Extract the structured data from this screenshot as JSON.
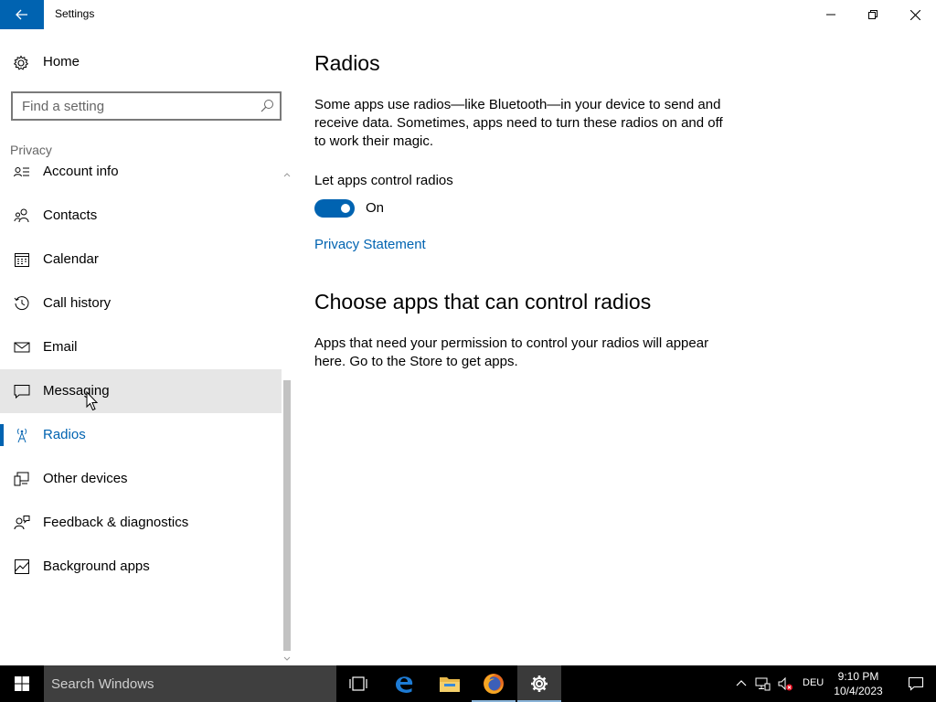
{
  "window": {
    "title": "Settings",
    "icons": {
      "back": "back-arrow-icon",
      "minimize": "minimize-icon",
      "maximize": "restore-icon",
      "close": "close-icon"
    }
  },
  "sidebar": {
    "home_label": "Home",
    "home_icon": "gear-icon",
    "search_placeholder": "Find a setting",
    "section_label": "Privacy",
    "items": [
      {
        "label": "Account info",
        "icon": "account-info-icon"
      },
      {
        "label": "Contacts",
        "icon": "contacts-icon"
      },
      {
        "label": "Calendar",
        "icon": "calendar-icon"
      },
      {
        "label": "Call history",
        "icon": "history-icon"
      },
      {
        "label": "Email",
        "icon": "mail-icon"
      },
      {
        "label": "Messaging",
        "icon": "chat-icon",
        "state": "hover"
      },
      {
        "label": "Radios",
        "icon": "radio-tower-icon",
        "state": "selected"
      },
      {
        "label": "Other devices",
        "icon": "devices-icon"
      },
      {
        "label": "Feedback & diagnostics",
        "icon": "feedback-icon"
      },
      {
        "label": "Background apps",
        "icon": "background-apps-icon"
      }
    ]
  },
  "main": {
    "title": "Radios",
    "description": "Some apps use radios—like Bluetooth—in your device to send and receive data. Sometimes, apps need to turn these radios on and off to work their magic.",
    "toggle_label": "Let apps control radios",
    "toggle_on": true,
    "toggle_state": "On",
    "privacy_link": "Privacy Statement",
    "subtitle": "Choose apps that can control radios",
    "sub_description": "Apps that need your permission to control your radios will appear here. Go to the Store to get apps."
  },
  "taskbar": {
    "search_placeholder": "Search Windows",
    "apps": [
      "task-view-icon",
      "edge-icon",
      "file-explorer-icon",
      "firefox-icon",
      "settings-icon"
    ],
    "active_app": "settings-icon",
    "tray": [
      "chevron-up-icon",
      "network-icon",
      "volume-muted-icon"
    ],
    "language": "DEU",
    "time": "9:10 PM",
    "date": "10/4/2023"
  },
  "colors": {
    "accent": "#0063b1",
    "hover_bg": "#e6e6e6",
    "taskbar_bg": "#000000",
    "taskbar_search_bg": "#3f3f3f"
  }
}
